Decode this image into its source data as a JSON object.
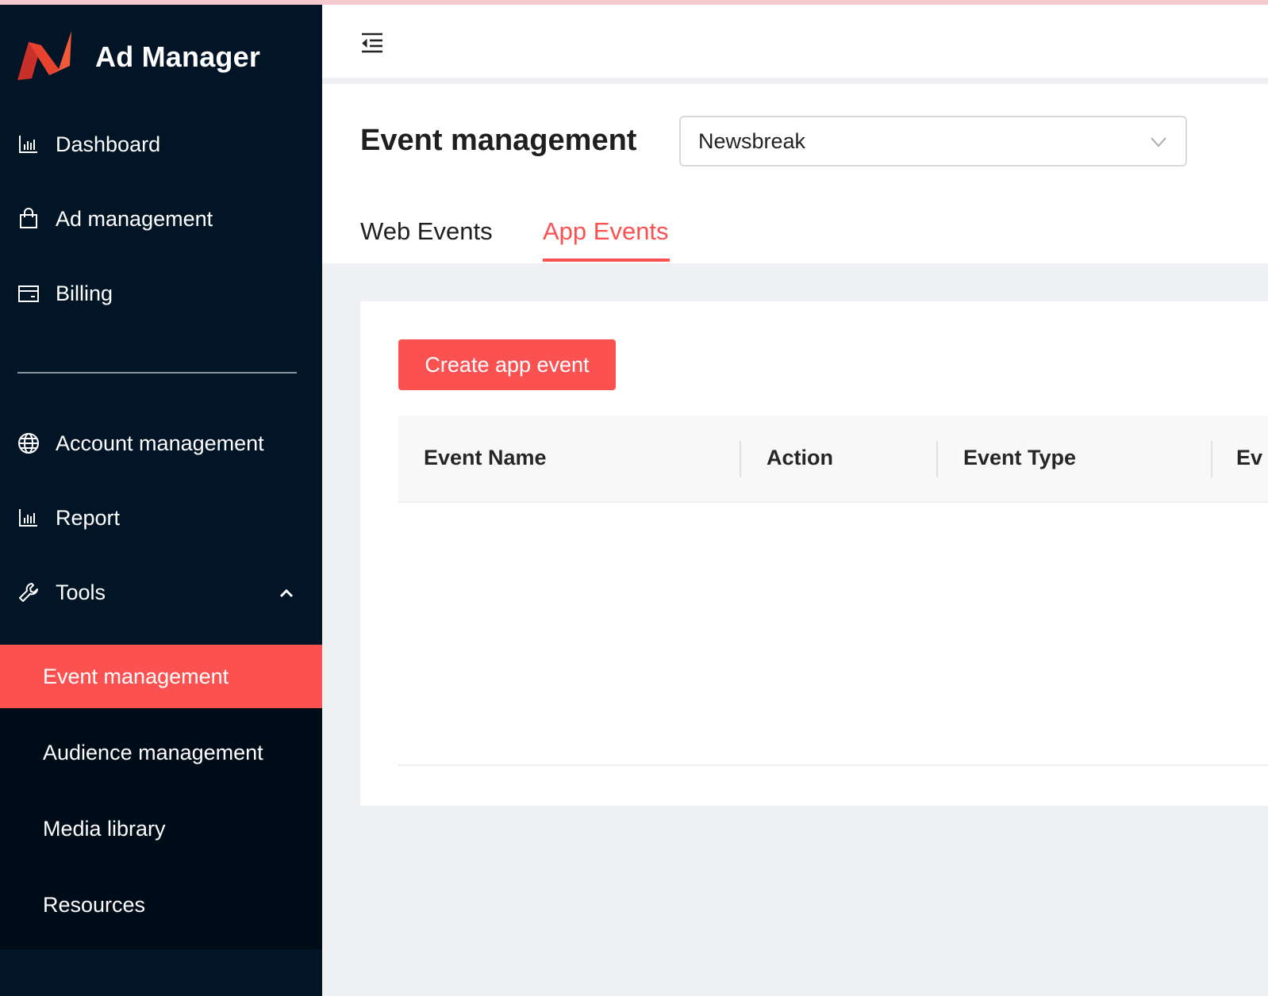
{
  "brand": {
    "title": "Ad Manager",
    "logo_colors": [
      "#e83a2e",
      "#f05a3a"
    ]
  },
  "sidebar": {
    "items": [
      {
        "label": "Dashboard",
        "icon": "bar-chart-icon"
      },
      {
        "label": "Ad management",
        "icon": "shopping-bag-icon"
      },
      {
        "label": "Billing",
        "icon": "credit-card-icon"
      },
      {
        "label": "Account management",
        "icon": "globe-icon"
      },
      {
        "label": "Report",
        "icon": "bar-chart-icon"
      },
      {
        "label": "Tools",
        "icon": "wrench-icon",
        "expanded": true
      }
    ],
    "tools_submenu": [
      {
        "label": "Event management",
        "active": true
      },
      {
        "label": "Audience management"
      },
      {
        "label": "Media library"
      },
      {
        "label": "Resources"
      }
    ]
  },
  "header": {
    "menu_icon": "menu-fold-icon"
  },
  "page": {
    "title": "Event management",
    "select_value": "Newsbreak",
    "tabs": [
      {
        "label": "Web Events",
        "active": false
      },
      {
        "label": "App Events",
        "active": true
      }
    ]
  },
  "card": {
    "create_button": "Create app event",
    "table": {
      "columns": [
        "Event Name",
        "Action",
        "Event Type",
        "Ev"
      ]
    }
  },
  "colors": {
    "accent": "#fb5151",
    "sidebar_bg": "#021526",
    "submenu_bg": "#000d19"
  }
}
